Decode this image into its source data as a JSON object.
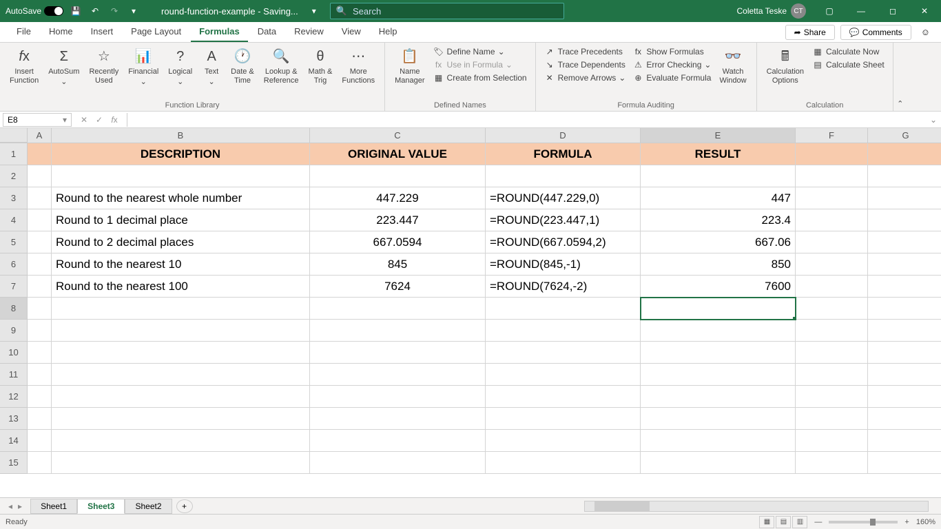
{
  "titlebar": {
    "autosave": "AutoSave",
    "autosave_state": "On",
    "filename": "round-function-example - Saving...",
    "search_placeholder": "Search",
    "user": "Coletta Teske",
    "user_initials": "CT"
  },
  "menu": {
    "tabs": [
      "File",
      "Home",
      "Insert",
      "Page Layout",
      "Formulas",
      "Data",
      "Review",
      "View",
      "Help"
    ],
    "active": "Formulas",
    "share": "Share",
    "comments": "Comments"
  },
  "ribbon": {
    "function_library": {
      "label": "Function Library",
      "insert_function": "Insert\nFunction",
      "autosum": "AutoSum",
      "recently": "Recently\nUsed",
      "financial": "Financial",
      "logical": "Logical",
      "text": "Text",
      "datetime": "Date &\nTime",
      "lookup": "Lookup &\nReference",
      "math": "Math &\nTrig",
      "more": "More\nFunctions"
    },
    "defined_names": {
      "label": "Defined Names",
      "name_manager": "Name\nManager",
      "define_name": "Define Name",
      "use_in_formula": "Use in Formula",
      "create_selection": "Create from Selection"
    },
    "formula_auditing": {
      "label": "Formula Auditing",
      "trace_precedents": "Trace Precedents",
      "trace_dependents": "Trace Dependents",
      "remove_arrows": "Remove Arrows",
      "show_formulas": "Show Formulas",
      "error_checking": "Error Checking",
      "evaluate": "Evaluate Formula",
      "watch": "Watch\nWindow"
    },
    "calculation": {
      "label": "Calculation",
      "options": "Calculation\nOptions",
      "calc_now": "Calculate Now",
      "calc_sheet": "Calculate Sheet"
    }
  },
  "formula_bar": {
    "namebox": "E8",
    "formula": ""
  },
  "columns": [
    "A",
    "B",
    "C",
    "D",
    "E",
    "F",
    "G"
  ],
  "headers": {
    "B": "DESCRIPTION",
    "C": "ORIGINAL VALUE",
    "D": "FORMULA",
    "E": "RESULT"
  },
  "rows": [
    {
      "n": 3,
      "B": "Round to the nearest whole number",
      "C": "447.229",
      "D": "=ROUND(447.229,0)",
      "E": "447"
    },
    {
      "n": 4,
      "B": "Round to 1 decimal place",
      "C": "223.447",
      "D": "=ROUND(223.447,1)",
      "E": "223.4"
    },
    {
      "n": 5,
      "B": "Round to 2 decimal places",
      "C": "667.0594",
      "D": "=ROUND(667.0594,2)",
      "E": "667.06"
    },
    {
      "n": 6,
      "B": "Round to the nearest 10",
      "C": "845",
      "D": "=ROUND(845,-1)",
      "E": "850"
    },
    {
      "n": 7,
      "B": "Round to the nearest 100",
      "C": "7624",
      "D": "=ROUND(7624,-2)",
      "E": "7600"
    }
  ],
  "selected_cell": "E8",
  "sheets": {
    "tabs": [
      "Sheet1",
      "Sheet3",
      "Sheet2"
    ],
    "active": "Sheet3"
  },
  "statusbar": {
    "ready": "Ready",
    "zoom": "160%"
  }
}
